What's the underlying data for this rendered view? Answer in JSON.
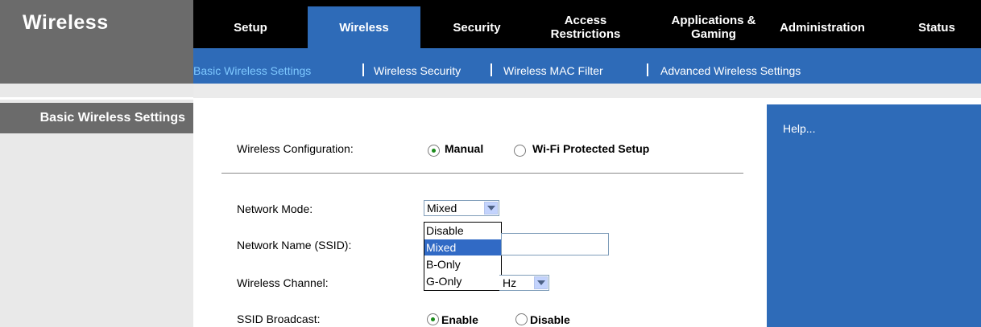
{
  "brand": {
    "title": "Wireless"
  },
  "tabs": [
    {
      "label": "Setup"
    },
    {
      "label": "Wireless"
    },
    {
      "label": "Security"
    },
    {
      "label": "Access Restrictions"
    },
    {
      "label": "Applications & Gaming"
    },
    {
      "label": "Administration"
    },
    {
      "label": "Status"
    }
  ],
  "subnav": [
    {
      "label": "Basic Wireless Settings"
    },
    {
      "label": "Wireless Security"
    },
    {
      "label": "Wireless MAC Filter"
    },
    {
      "label": "Advanced Wireless Settings"
    }
  ],
  "section": {
    "title": "Basic Wireless Settings"
  },
  "help": {
    "label": "Help..."
  },
  "form": {
    "config": {
      "label": "Wireless Configuration:",
      "options": [
        "Manual",
        "Wi-Fi Protected Setup"
      ],
      "selected": "Manual"
    },
    "network_mode": {
      "label": "Network Mode:",
      "value": "Mixed",
      "options": [
        "Disable",
        "Mixed",
        "B-Only",
        "G-Only"
      ],
      "highlighted": "Mixed"
    },
    "ssid": {
      "label": "Network Name (SSID):",
      "value": ""
    },
    "channel": {
      "label": "Wireless Channel:",
      "value_fragment": "Hz"
    },
    "broadcast": {
      "label": "SSID Broadcast:",
      "options": [
        "Enable",
        "Disable"
      ],
      "selected": "Enable"
    }
  },
  "colors": {
    "accent_blue": "#2e6bb8",
    "brand_grey": "#6b6b6b",
    "highlight": "#316ac5",
    "radio_dot": "#1b8a1b"
  }
}
